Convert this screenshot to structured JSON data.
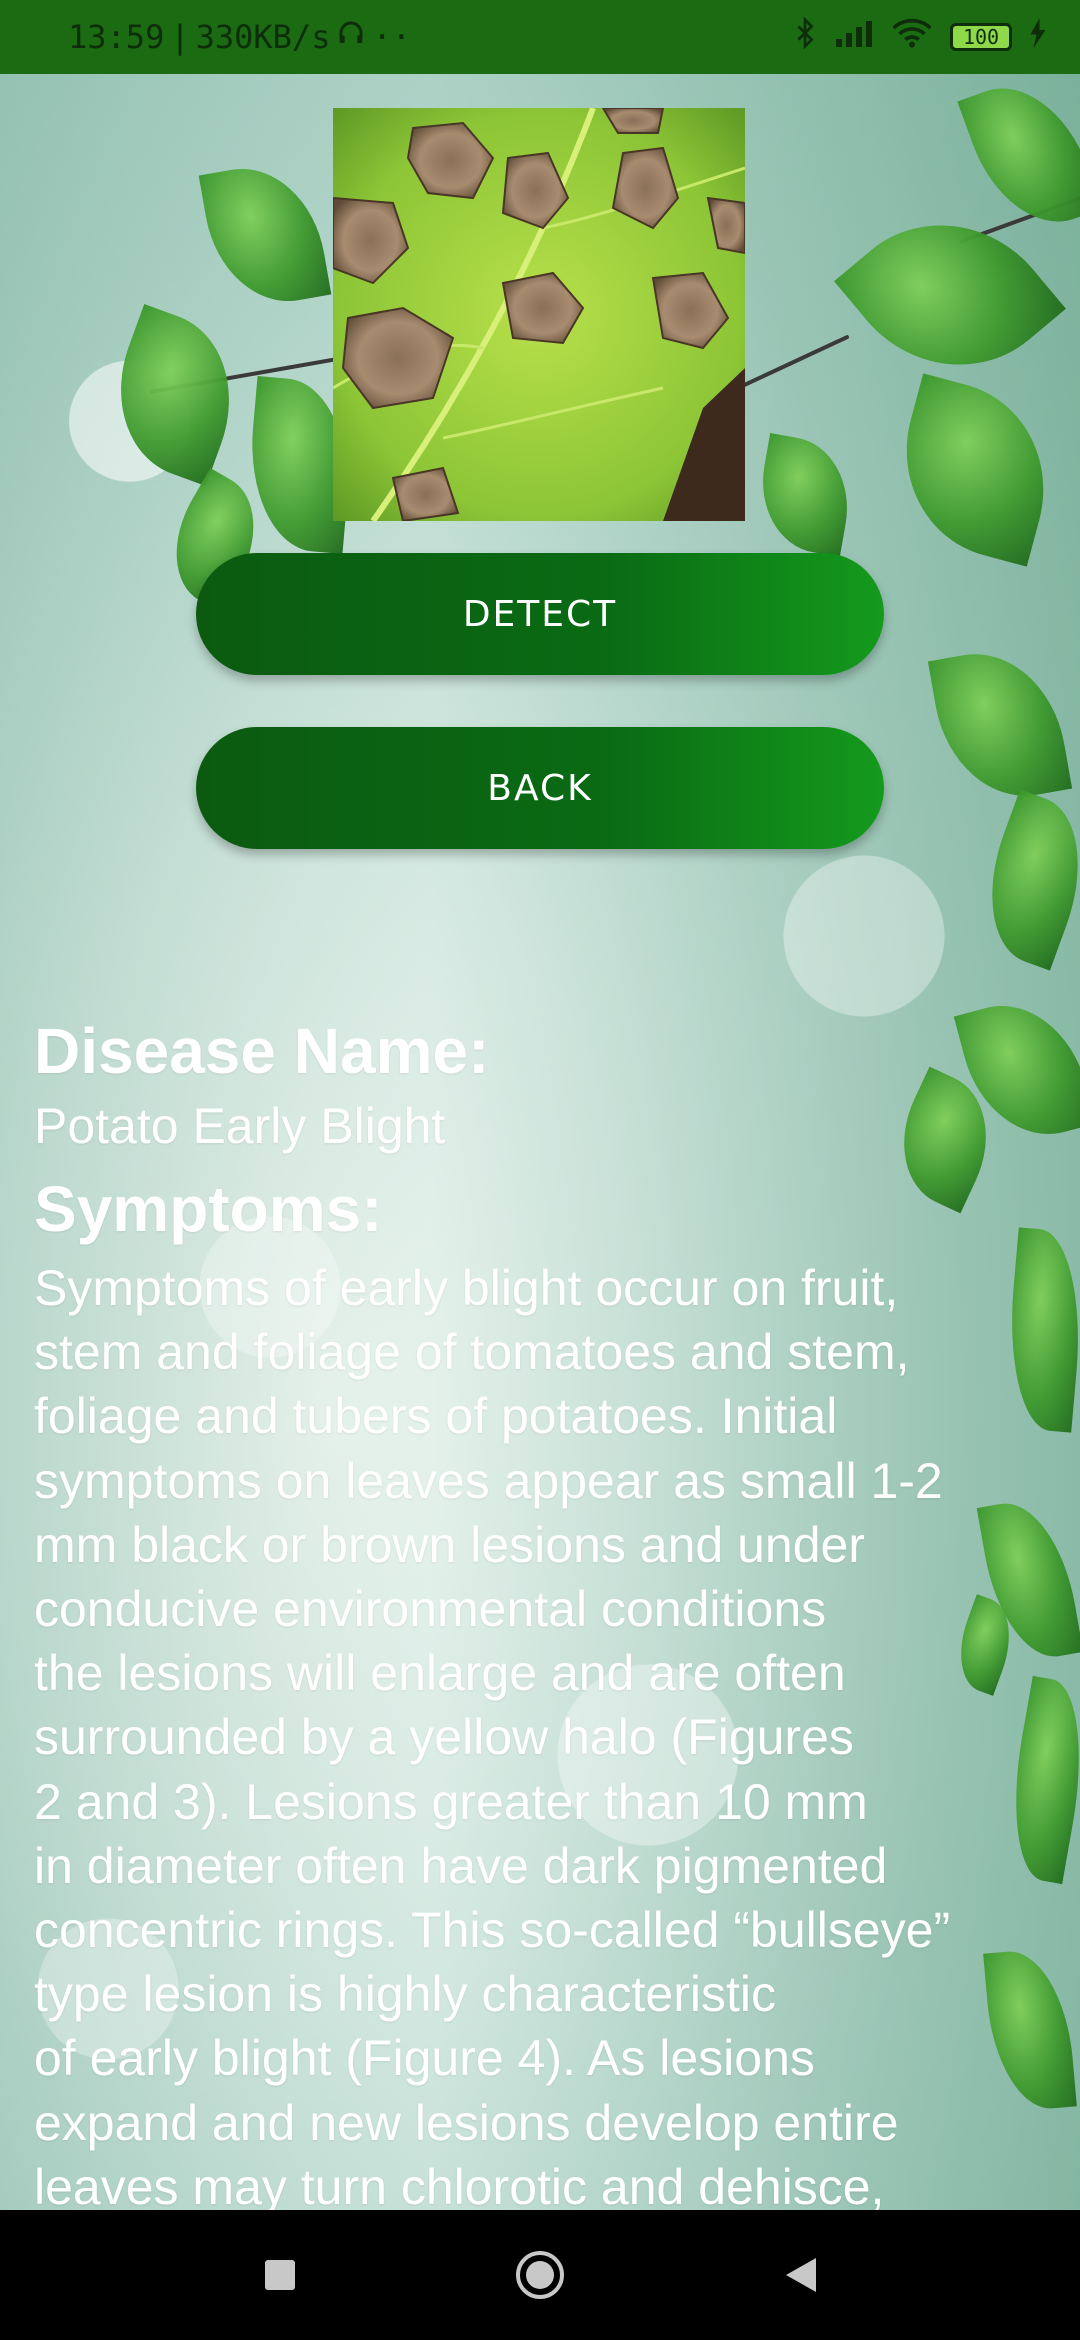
{
  "status_bar": {
    "time": "13:59",
    "network_speed": "330KB/s",
    "battery_level": "100",
    "icons": [
      "headphones-icon",
      "bluetooth-icon",
      "signal-icon",
      "wifi-icon",
      "battery-icon",
      "charging-icon"
    ]
  },
  "image": {
    "subject": "leaf-with-blight-lesions"
  },
  "buttons": {
    "detect_label": "DETECT",
    "back_label": "BACK"
  },
  "result": {
    "disease_heading": "Disease Name:",
    "disease_name": "Potato Early Blight",
    "symptoms_heading": "Symptoms:",
    "symptoms_text": "Symptoms of early blight occur on fruit,\nstem and foliage of tomatoes and stem,\nfoliage and tubers of potatoes. Initial\nsymptoms on leaves appear as small 1-2\nmm black or brown lesions and under\nconducive environmental conditions\nthe lesions will enlarge and are often\nsurrounded by a yellow halo (Figures\n2 and 3). Lesions greater than 10 mm\nin diameter often have dark pigmented\nconcentric rings. This so-called “bullseye”\ntype lesion is highly characteristic\nof early blight (Figure 4). As lesions\nexpand and new lesions develop entire\nleaves may turn chlorotic and dehisce,"
  },
  "colors": {
    "status_bar": "#1a6b12",
    "button_dark": "#0b5a10",
    "button_light": "#149a1c",
    "text": "#ffffff",
    "nav_bar": "#000000"
  }
}
